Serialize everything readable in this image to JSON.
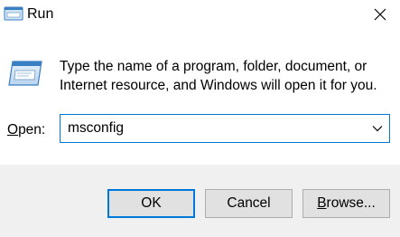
{
  "window": {
    "title": "Run",
    "close_glyph": "✕"
  },
  "icons": {
    "title_icon": "run-icon",
    "body_icon": "run-icon",
    "close_icon": "close-icon",
    "dropdown_icon": "chevron-down-icon"
  },
  "body": {
    "description_line1": "Type the name of a program, folder, document, or",
    "description_line2": "Internet resource, and Windows will open it for you.",
    "open_label_accel": "O",
    "open_label_rest": "pen:",
    "open_value": "msconfig"
  },
  "buttons": {
    "ok": "OK",
    "cancel": "Cancel",
    "browse_accel": "B",
    "browse_rest": "rowse..."
  },
  "colors": {
    "accent": "#0078d7",
    "footer_bg": "#f0f0f0",
    "button_bg": "#e1e1e1",
    "button_border": "#adadad"
  }
}
